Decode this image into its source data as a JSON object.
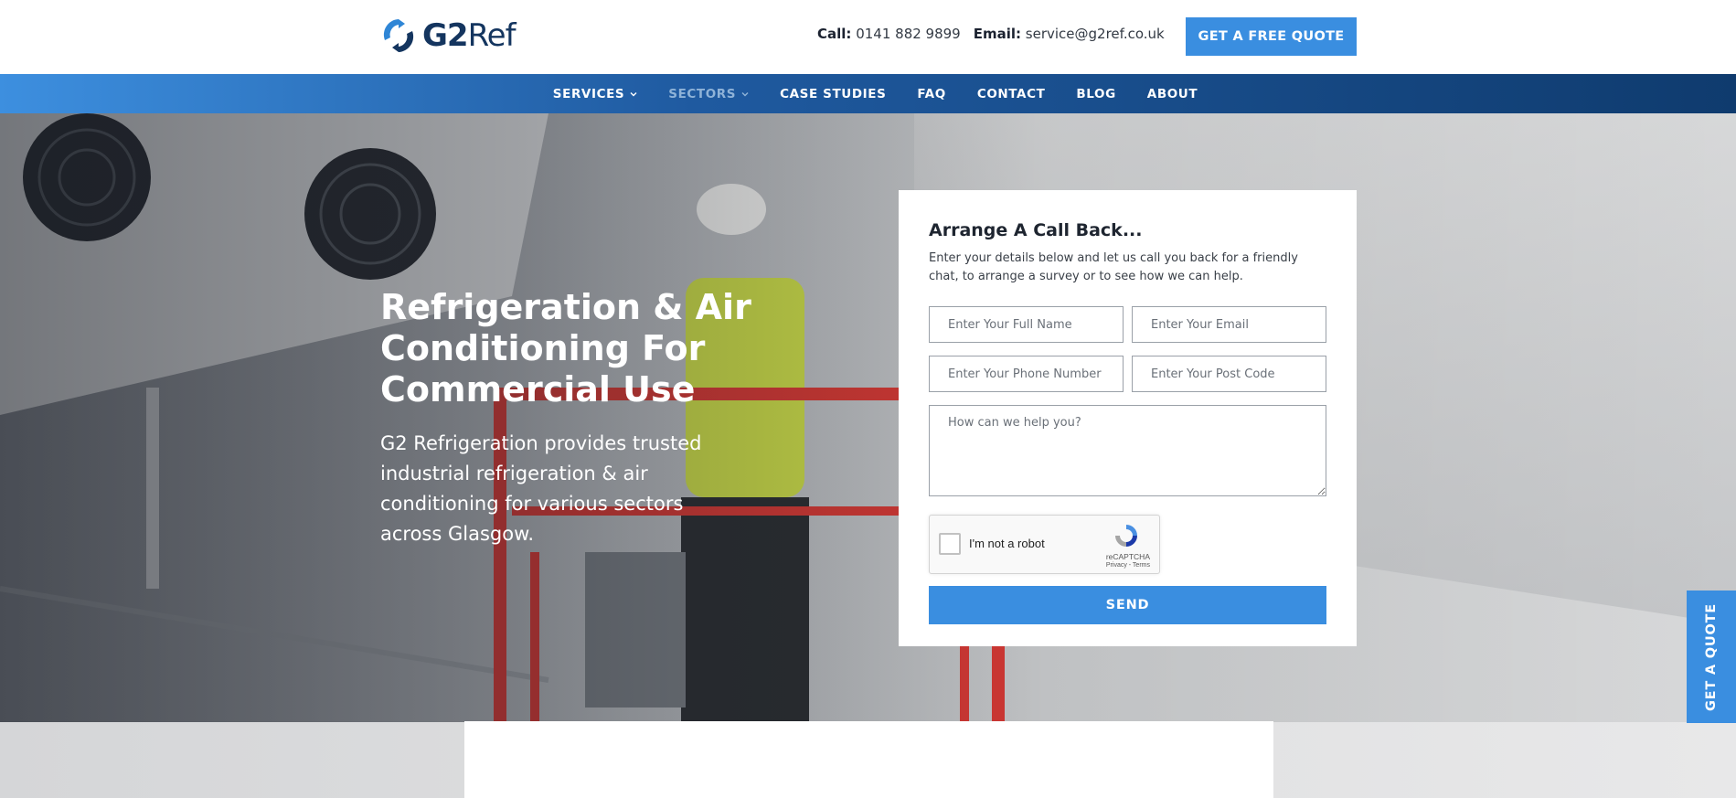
{
  "header": {
    "logo_text_bold": "G2",
    "logo_text_light": "Ref",
    "call_label": "Call:",
    "call_value": "0141 882 9899",
    "email_label": "Email:",
    "email_value": "service@g2ref.co.uk",
    "quote_button": "GET A FREE QUOTE"
  },
  "nav": {
    "items": [
      {
        "label": "SERVICES",
        "has_dropdown": true
      },
      {
        "label": "SECTORS",
        "has_dropdown": true
      },
      {
        "label": "CASE STUDIES"
      },
      {
        "label": "FAQ"
      },
      {
        "label": "CONTACT"
      },
      {
        "label": "BLOG"
      },
      {
        "label": "ABOUT"
      }
    ]
  },
  "hero": {
    "title": "Refrigeration & Air Conditioning For Commercial Use",
    "subtitle": "G2 Refrigeration provides trusted industrial refrigeration & air conditioning for various sectors across Glasgow."
  },
  "form": {
    "title": "Arrange A Call Back...",
    "description": "Enter your details below and let us call you back for a friendly chat, to arrange a survey or to see how we can help.",
    "name_placeholder": "Enter Your Full Name",
    "email_placeholder": "Enter Your Email",
    "phone_placeholder": "Enter Your Phone Number",
    "postcode_placeholder": "Enter Your Post Code",
    "message_placeholder": "How can we help you?",
    "recaptcha_label": "I'm not a robot",
    "recaptcha_brand": "reCAPTCHA",
    "recaptcha_terms": "Privacy - Terms",
    "send_button": "SEND"
  },
  "side_tab": {
    "label": "GET A QUOTE"
  },
  "colors": {
    "accent": "#3a8ee0",
    "nav_dark": "#0f3b6e",
    "logo_navy": "#14355f"
  }
}
